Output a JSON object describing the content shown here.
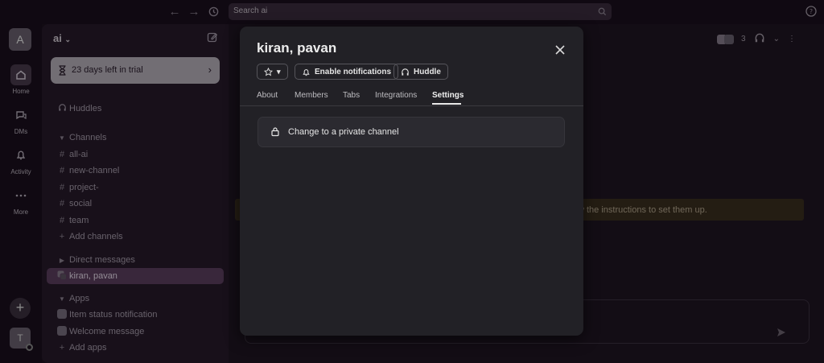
{
  "topbar": {
    "search_placeholder": "Search ai"
  },
  "rail": {
    "workspace_initial": "A",
    "items": [
      {
        "label": "Home",
        "icon": "home-icon"
      },
      {
        "label": "DMs",
        "icon": "dms-icon"
      },
      {
        "label": "Activity",
        "icon": "bell-icon"
      },
      {
        "label": "More",
        "icon": "more-dots-icon"
      }
    ],
    "user_initial": "T"
  },
  "sidebar": {
    "workspace": "ai",
    "trial": "23 days left in trial",
    "huddles": "Huddles",
    "channels_header": "Channels",
    "channels": [
      "all-ai",
      "new-channel",
      "project-",
      "social",
      "team"
    ],
    "add_channels": "Add channels",
    "dm_header": "Direct messages",
    "dm_active": "kiran, pavan",
    "apps_header": "Apps",
    "apps": [
      "Item status notification",
      "Welcome message"
    ],
    "add_apps": "Add apps"
  },
  "main": {
    "member_count": "3",
    "banner_text": "w the instructions to set them up."
  },
  "modal": {
    "title": "kiran, pavan",
    "star_label": "",
    "notifications_label": "Enable notifications",
    "huddle_label": "Huddle",
    "tabs": [
      "About",
      "Members",
      "Tabs",
      "Integrations",
      "Settings"
    ],
    "active_tab": "Settings",
    "setting_option": "Change to a private channel"
  }
}
